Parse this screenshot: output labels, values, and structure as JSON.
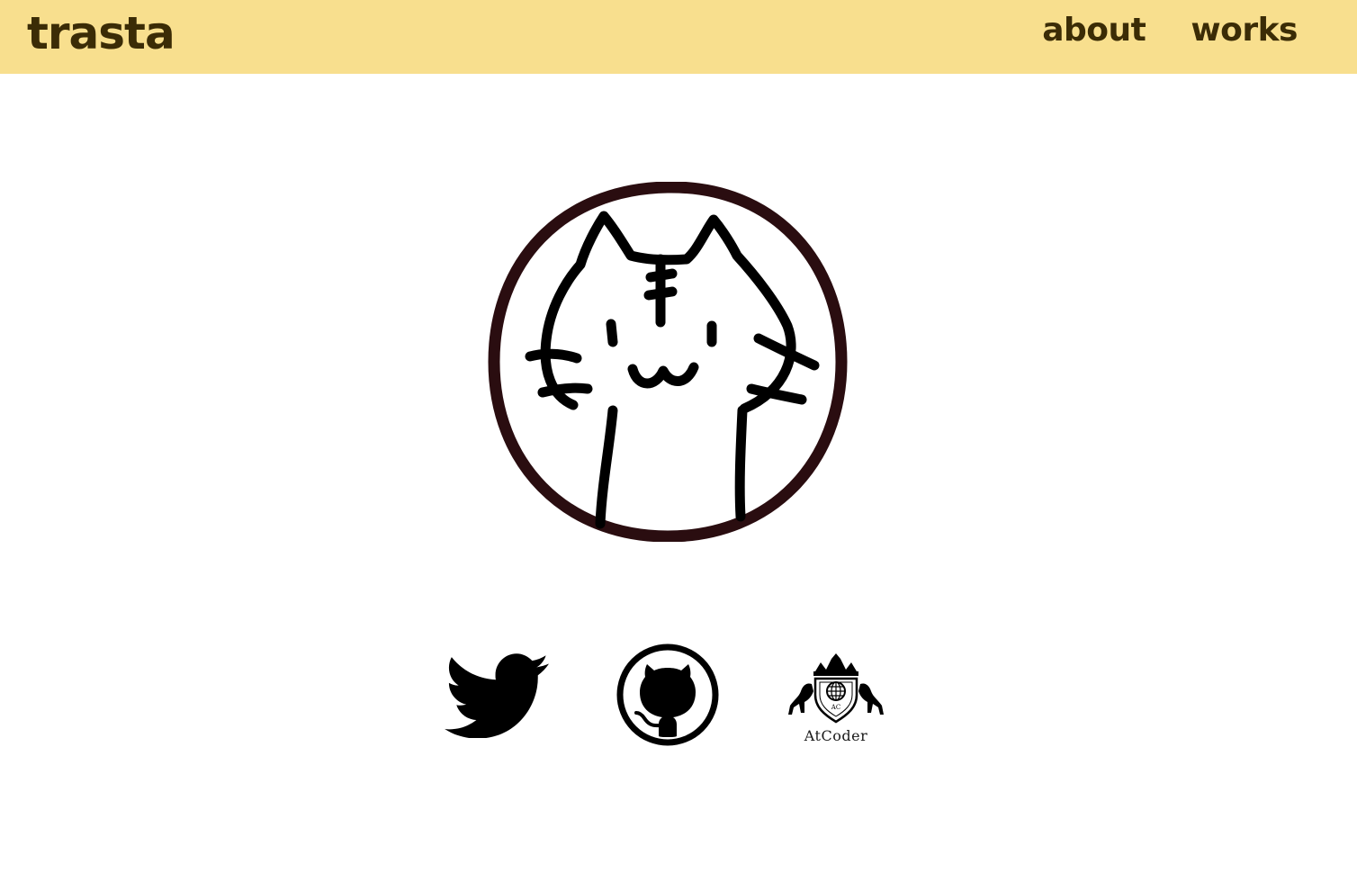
{
  "header": {
    "brand": "trasta",
    "nav": [
      {
        "label": "about"
      },
      {
        "label": "works"
      }
    ],
    "background_color": "#f8df8e",
    "text_color": "#3b2c06"
  },
  "avatar": {
    "icon": "cat-drawing-avatar",
    "border_color": "#2a0d10"
  },
  "social": {
    "links": [
      {
        "icon": "twitter-bird-icon"
      },
      {
        "icon": "github-octocat-icon"
      },
      {
        "icon": "atcoder-crest-icon",
        "label": "AtCoder"
      }
    ]
  }
}
